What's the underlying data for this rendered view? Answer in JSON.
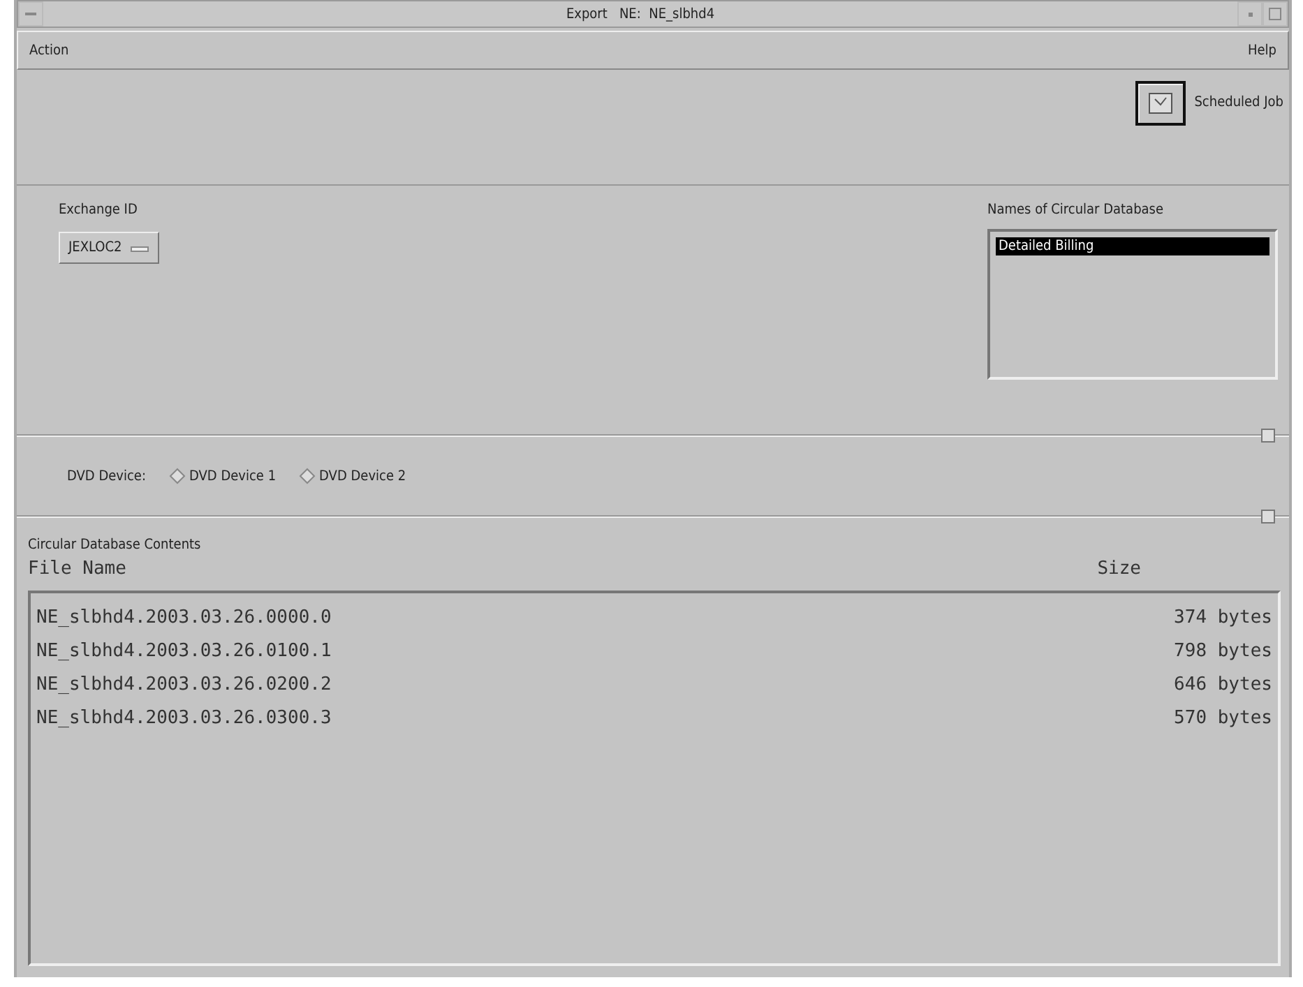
{
  "window": {
    "title": "Export   NE:  NE_slbhd4"
  },
  "menu_bar": {
    "items": [
      "Action",
      "Help"
    ]
  },
  "toolbar": {
    "scheduled_job": "Scheduled Job"
  },
  "exchange": {
    "label": "Exchange ID",
    "value": "JEXLOC2"
  },
  "databases": {
    "label": "Names of Circular Database",
    "items": [
      {
        "text": "Detailed Billing",
        "selected": true
      }
    ]
  },
  "dvd": {
    "label": "DVD Device:",
    "options": [
      {
        "label": "DVD Device 1",
        "selected": false
      },
      {
        "label": "DVD Device 2",
        "selected": false
      }
    ]
  },
  "contents": {
    "title": "Circular Database Contents",
    "columns": [
      "File Name",
      "Size"
    ],
    "rows": [
      {
        "name": "NE_slbhd4.2003.03.26.0000.0",
        "size": "374 bytes"
      },
      {
        "name": "NE_slbhd4.2003.03.26.0100.1",
        "size": "798 bytes"
      },
      {
        "name": "NE_slbhd4.2003.03.26.0200.2",
        "size": "646 bytes"
      },
      {
        "name": "NE_slbhd4.2003.03.26.0300.3",
        "size": "570 bytes"
      }
    ]
  }
}
